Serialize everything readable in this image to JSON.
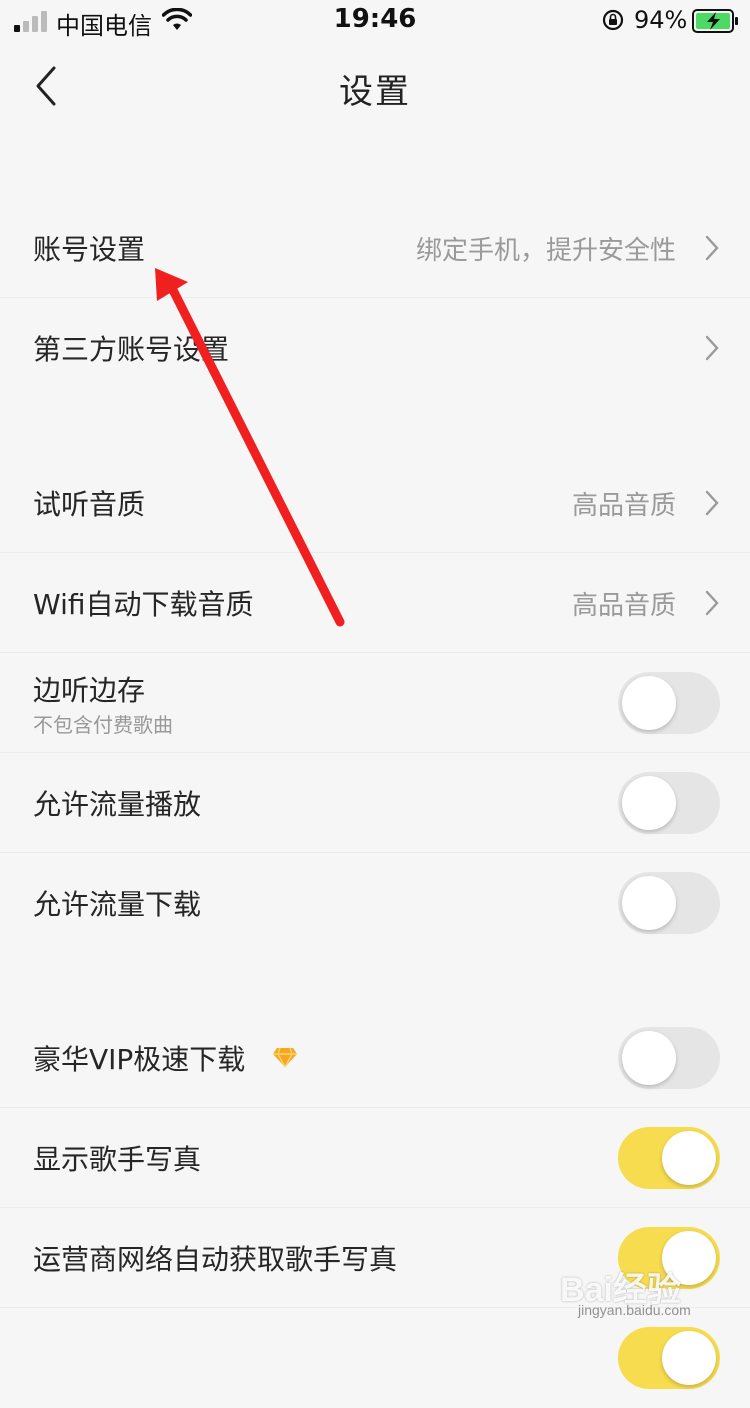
{
  "status_bar": {
    "carrier": "中国电信",
    "time": "19:46",
    "battery": "94%"
  },
  "nav": {
    "title": "设置"
  },
  "rows": [
    {
      "label": "账号设置",
      "value": "绑定手机，提升安全性"
    },
    {
      "label": "第三方账号设置"
    },
    {
      "label": "试听音质",
      "value": "高品音质"
    },
    {
      "label": "Wifi自动下载音质",
      "value": "高品音质"
    },
    {
      "label": "边听边存",
      "sublabel": "不包含付费歌曲",
      "toggle": false
    },
    {
      "label": "允许流量播放",
      "toggle": false
    },
    {
      "label": "允许流量下载",
      "toggle": false
    },
    {
      "label": "豪华VIP极速下载",
      "icon": "vip-diamond-icon",
      "toggle": false
    },
    {
      "label": "显示歌手写真",
      "toggle": true
    },
    {
      "label": "运营商网络自动获取歌手写真",
      "toggle": true
    }
  ],
  "colors": {
    "accent_toggle_on": "#f7dc4f",
    "toggle_off": "#e5e5e5",
    "background": "#f6f6f6",
    "annotation_arrow": "#f02020"
  },
  "watermark": {
    "text": "Bai经验",
    "url": "jingyan.baidu.com"
  }
}
